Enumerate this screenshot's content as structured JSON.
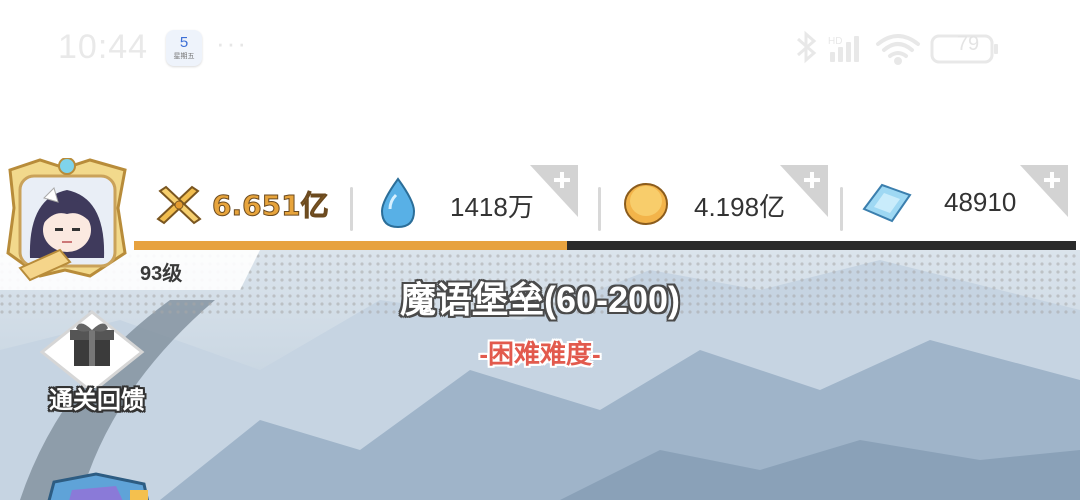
{
  "status_bar": {
    "time": "10:44",
    "calendar_day": "5",
    "calendar_label": "星期五",
    "more": "···",
    "battery": "79"
  },
  "player": {
    "level": "93级",
    "exp_progress": 0.46
  },
  "resources": {
    "power": "6.651亿",
    "water": "1418万",
    "gold": "4.198亿",
    "diamond": "48910"
  },
  "stage": {
    "title": "魔语堡垒(60-200)",
    "difficulty": "-困难难度-"
  },
  "buttons": {
    "clear_reward": "通关回馈"
  },
  "colors": {
    "progress_fill": "#e7a23f",
    "progress_track": "#2b2b2b",
    "power_text": "#e7a43c",
    "difficulty_text": "#e25a4d",
    "sky": "#c8d6e3"
  }
}
